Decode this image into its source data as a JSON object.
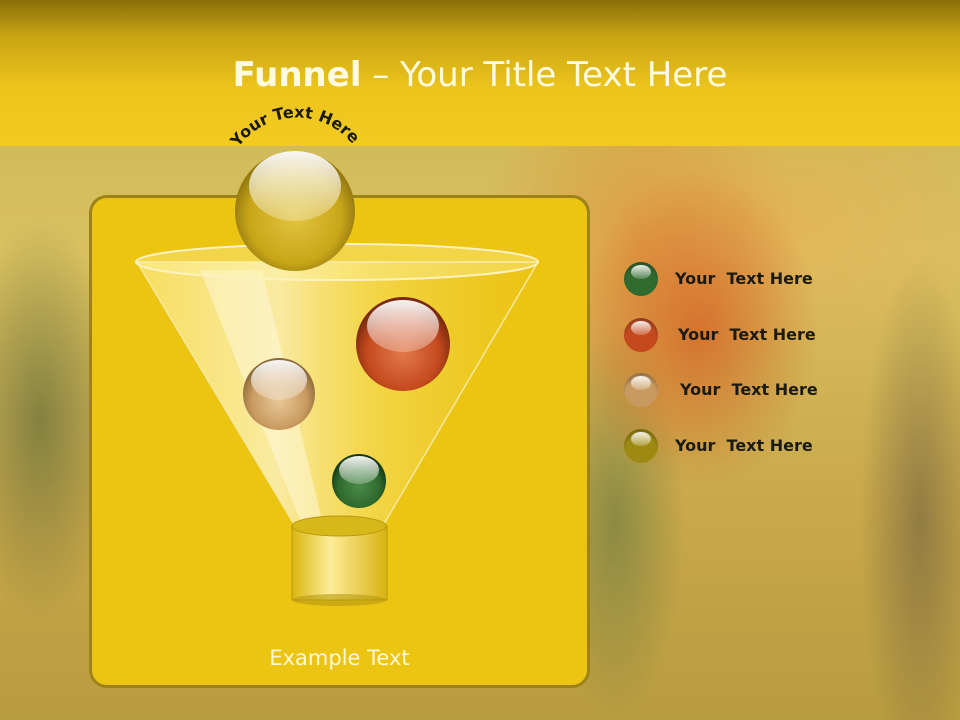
{
  "slide": {
    "title_bold": "Funnel",
    "title_rest": " – Your Title Text Here",
    "arc_text": "Your Text Here",
    "example_text": "Example Text"
  },
  "legend": [
    {
      "label": "Your  Text Here",
      "color": "#2f6a2e",
      "icon": "green-ball-icon"
    },
    {
      "label": "Your  Text Here",
      "color": "#c44a1e",
      "icon": "orange-ball-icon"
    },
    {
      "label": "Your  Text Here",
      "color": "#c99a60",
      "icon": "tan-ball-icon"
    },
    {
      "label": "Your  Text Here",
      "color": "#9e8a10",
      "icon": "gold-ball-icon"
    }
  ],
  "colors": {
    "header": "#ecc41c",
    "panel": "#ecc412",
    "panel_border": "#9c8218"
  }
}
